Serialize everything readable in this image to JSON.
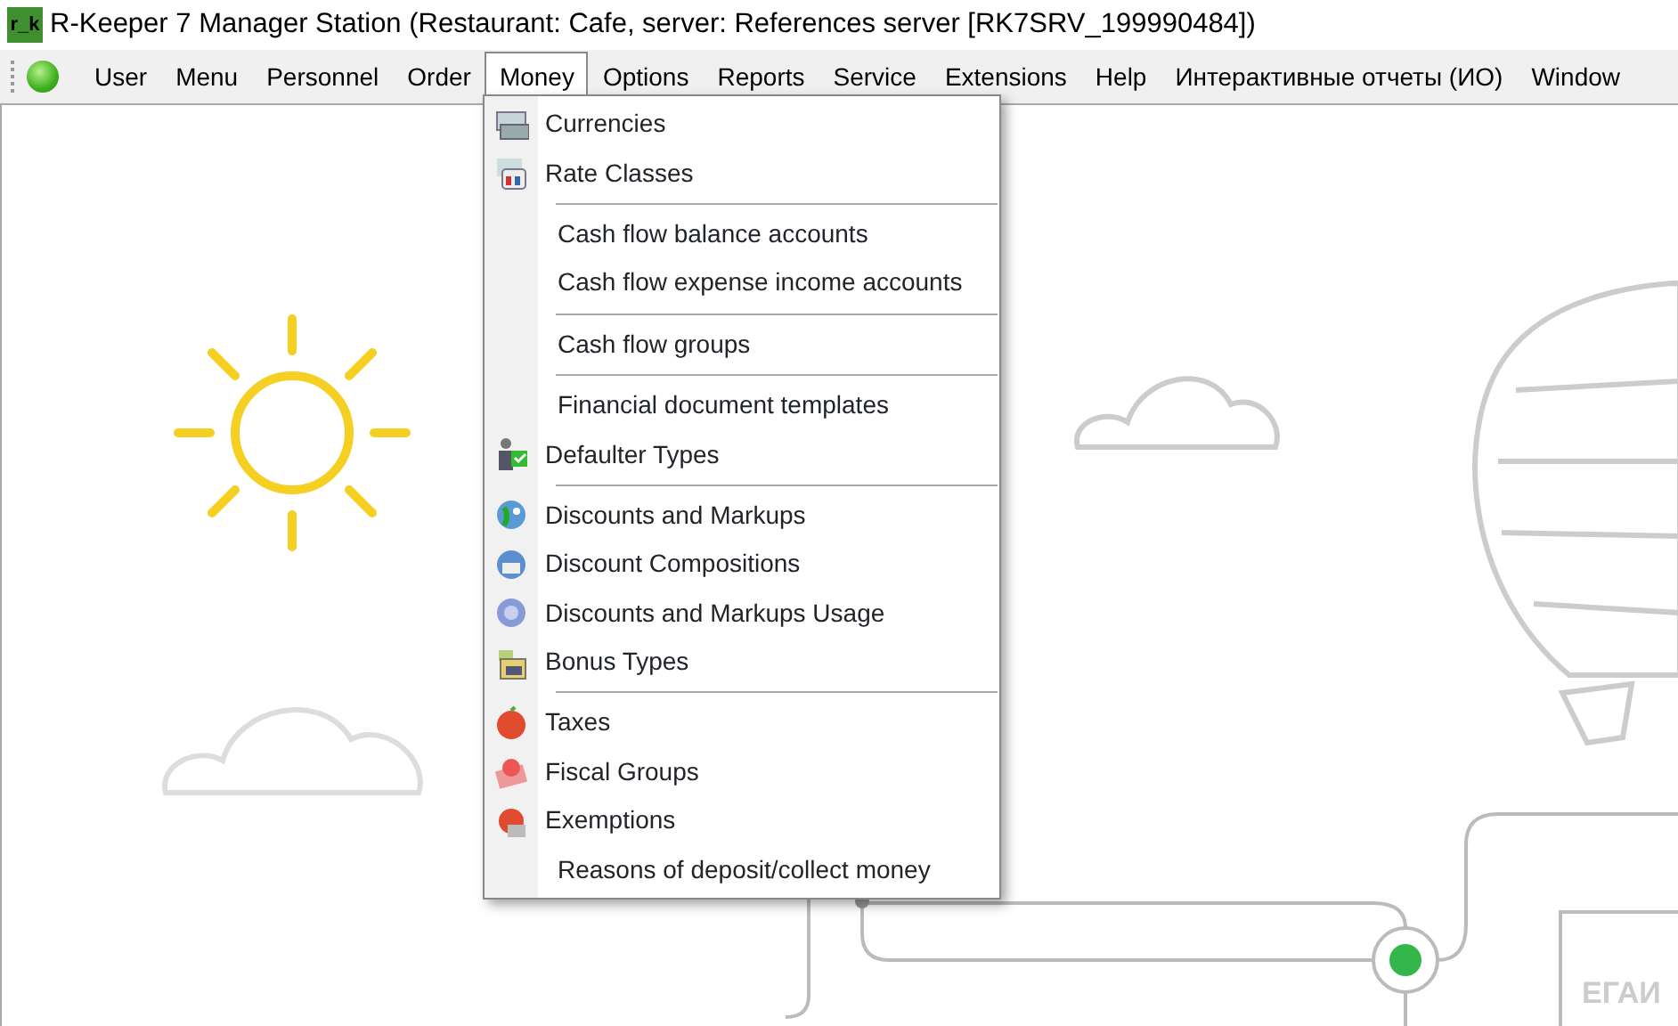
{
  "window": {
    "title": "R-Keeper 7 Manager Station (Restaurant: Cafe, server: References server [RK7SRV_199990484])",
    "logo": "r_k"
  },
  "menubar": [
    {
      "label": "User",
      "selected": false
    },
    {
      "label": "Menu",
      "selected": false
    },
    {
      "label": "Personnel",
      "selected": false
    },
    {
      "label": "Order",
      "selected": false
    },
    {
      "label": "Money",
      "selected": true
    },
    {
      "label": "Options",
      "selected": false
    },
    {
      "label": "Reports",
      "selected": false
    },
    {
      "label": "Service",
      "selected": false
    },
    {
      "label": "Extensions",
      "selected": false
    },
    {
      "label": "Help",
      "selected": false
    },
    {
      "label": "Интерактивные отчеты (ИО)",
      "selected": false
    },
    {
      "label": "Window",
      "selected": false
    }
  ],
  "dropdown": [
    {
      "kind": "item",
      "label": "Currencies"
    },
    {
      "kind": "item",
      "label": "Rate Classes"
    },
    {
      "kind": "separator"
    },
    {
      "kind": "item",
      "label": "Cash flow balance accounts"
    },
    {
      "kind": "item",
      "label": "Cash flow expense income accounts"
    },
    {
      "kind": "separator"
    },
    {
      "kind": "item",
      "label": "Cash flow groups"
    },
    {
      "kind": "separator"
    },
    {
      "kind": "item",
      "label": "Financial document templates"
    },
    {
      "kind": "item",
      "label": "Defaulter Types"
    },
    {
      "kind": "separator"
    },
    {
      "kind": "item",
      "label": "Discounts and Markups"
    },
    {
      "kind": "item",
      "label": "Discount Compositions"
    },
    {
      "kind": "item",
      "label": "Discounts and Markups Usage"
    },
    {
      "kind": "item",
      "label": "Bonus Types"
    },
    {
      "kind": "separator"
    },
    {
      "kind": "item",
      "label": "Taxes"
    },
    {
      "kind": "item",
      "label": "Fiscal Groups"
    },
    {
      "kind": "item",
      "label": "Exemptions"
    },
    {
      "kind": "item",
      "label": "Reasons of deposit/collect money"
    }
  ],
  "background": {
    "sign_text": "ЕГАИ"
  }
}
